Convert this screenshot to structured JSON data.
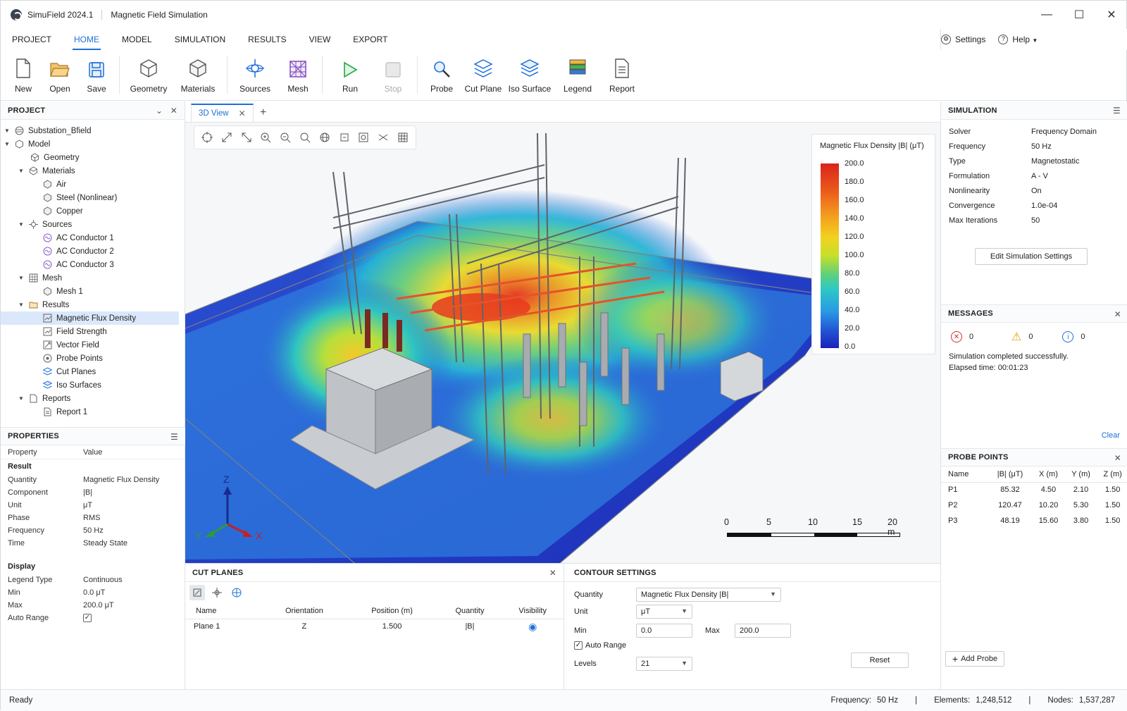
{
  "titlebar": {
    "app": "SimuField 2024.1",
    "doc": "Magnetic Field Simulation",
    "min": "—",
    "max": "☐",
    "close": "✕"
  },
  "menu": {
    "items": [
      "PROJECT",
      "HOME",
      "MODEL",
      "SIMULATION",
      "RESULTS",
      "VIEW",
      "EXPORT"
    ],
    "active": "HOME",
    "settings": "Settings",
    "help": "Help"
  },
  "ribbon": {
    "new": "New",
    "open": "Open",
    "save": "Save",
    "geometry": "Geometry",
    "materials": "Materials",
    "sources": "Sources",
    "mesh": "Mesh",
    "run": "Run",
    "stop": "Stop",
    "probe": "Probe",
    "cut_plane": "Cut Plane",
    "iso_surface": "Iso Surface",
    "legend": "Legend",
    "report": "Report"
  },
  "project": {
    "title": "PROJECT",
    "root": "Substation_Bfield",
    "model": "Model",
    "geometry": "Geometry",
    "materials": "Materials",
    "air": "Air",
    "steel": "Steel (Nonlinear)",
    "copper": "Copper",
    "sources": "Sources",
    "ac1": "AC Conductor 1",
    "ac2": "AC Conductor 2",
    "ac3": "AC Conductor 3",
    "mesh": "Mesh",
    "mesh1": "Mesh 1",
    "results": "Results",
    "mfd": "Magnetic Flux Density",
    "fs": "Field Strength",
    "vf": "Vector Field",
    "pp": "Probe Points",
    "cp": "Cut Planes",
    "iso": "Iso Surfaces",
    "reports": "Reports",
    "report1": "Report 1"
  },
  "properties": {
    "title": "PROPERTIES",
    "h_prop": "Property",
    "h_val": "Value",
    "result": "Result",
    "quantity_k": "Quantity",
    "quantity_v": "Magnetic Flux Density",
    "component_k": "Component",
    "component_v": "|B|",
    "unit_k": "Unit",
    "unit_v": "μT",
    "phase_k": "Phase",
    "phase_v": "RMS",
    "freq_k": "Frequency",
    "freq_v": "50 Hz",
    "time_k": "Time",
    "time_v": "Steady State",
    "display": "Display",
    "ltype_k": "Legend Type",
    "ltype_v": "Continuous",
    "min_k": "Min",
    "min_v": "0.0 μT",
    "max_k": "Max",
    "max_v": "200.0 μT",
    "auto_k": "Auto Range"
  },
  "view": {
    "tab": "3D View",
    "axis_x": "X",
    "axis_y": "Y",
    "axis_z": "Z"
  },
  "legend": {
    "title": "Magnetic Flux Density |B| (μT)",
    "ticks": [
      "200.0",
      "180.0",
      "160.0",
      "140.0",
      "120.0",
      "100.0",
      "80.0",
      "60.0",
      "40.0",
      "20.0",
      "0.0"
    ]
  },
  "scale": {
    "labels": [
      "0",
      "5",
      "10",
      "15",
      "20 m"
    ]
  },
  "cut_planes": {
    "title": "CUT PLANES",
    "headers": [
      "Name",
      "Orientation",
      "Position (m)",
      "Quantity",
      "Visibility"
    ],
    "row": {
      "name": "Plane 1",
      "orientation": "Z",
      "position": "1.500",
      "quantity": "|B|"
    }
  },
  "contour": {
    "title": "CONTOUR SETTINGS",
    "quantity_k": "Quantity",
    "quantity_v": "Magnetic Flux Density |B|",
    "unit_k": "Unit",
    "unit_v": "μT",
    "min_k": "Min",
    "min_v": "0.0",
    "max_k": "Max",
    "max_v": "200.0",
    "auto": "Auto Range",
    "levels_k": "Levels",
    "levels_v": "21",
    "reset": "Reset"
  },
  "simulation": {
    "title": "SIMULATION",
    "rows": [
      [
        "Solver",
        "Frequency Domain"
      ],
      [
        "Frequency",
        "50 Hz"
      ],
      [
        "Type",
        "Magnetostatic"
      ],
      [
        "Formulation",
        "A - V"
      ],
      [
        "Nonlinearity",
        "On"
      ],
      [
        "Convergence",
        "1.0e-04"
      ],
      [
        "Max Iterations",
        "50"
      ]
    ],
    "edit": "Edit Simulation Settings"
  },
  "messages": {
    "title": "MESSAGES",
    "err": "0",
    "warn": "0",
    "info": "0",
    "line1": "Simulation completed successfully.",
    "line2": "Elapsed time: 00:01:23",
    "clear": "Clear"
  },
  "probes": {
    "title": "PROBE POINTS",
    "headers": [
      "Name",
      "|B| (μT)",
      "X (m)",
      "Y (m)",
      "Z (m)"
    ],
    "rows": [
      [
        "P1",
        "85.32",
        "4.50",
        "2.10",
        "1.50"
      ],
      [
        "P2",
        "120.47",
        "10.20",
        "5.30",
        "1.50"
      ],
      [
        "P3",
        "48.19",
        "15.60",
        "3.80",
        "1.50"
      ]
    ],
    "add": "Add Probe"
  },
  "status": {
    "ready": "Ready",
    "freq_k": "Frequency:",
    "freq_v": "50 Hz",
    "sep": "|",
    "elem_k": "Elements:",
    "elem_v": "1,248,512",
    "nodes_k": "Nodes:",
    "nodes_v": "1,537,287"
  }
}
